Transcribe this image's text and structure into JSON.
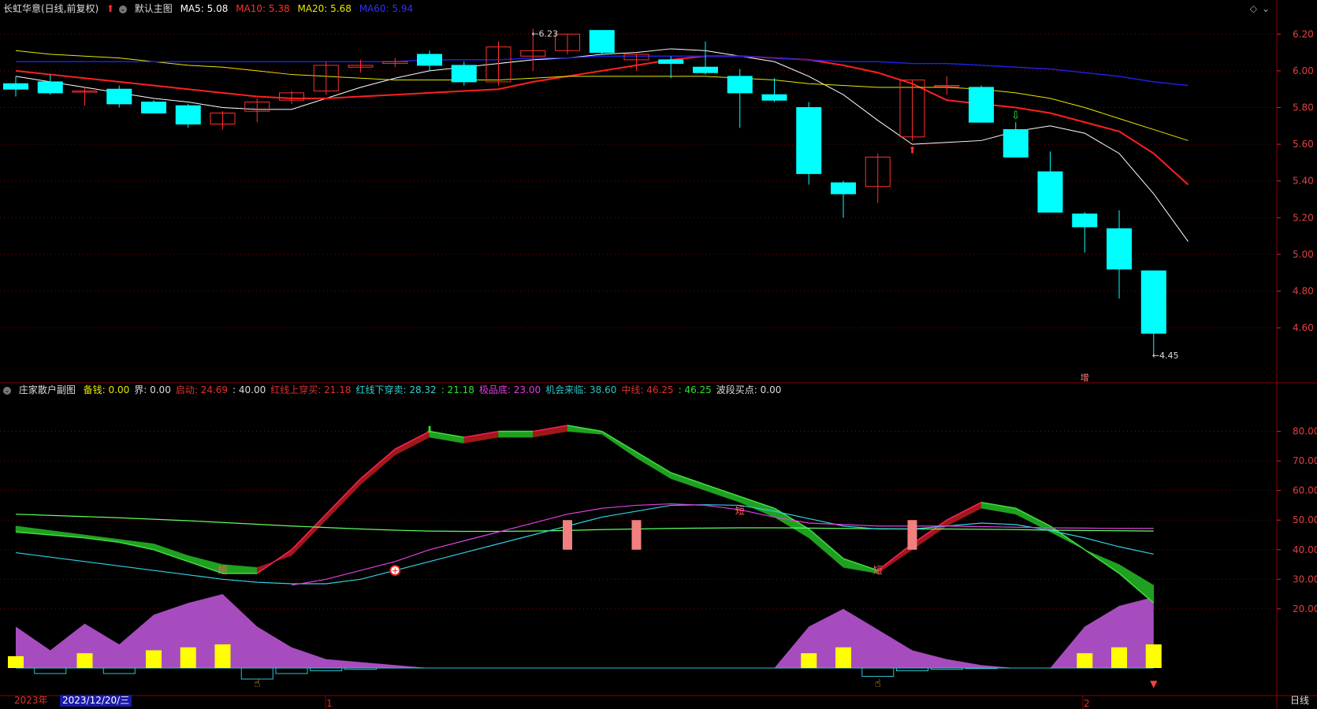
{
  "header": {
    "stock_name": "长虹华意(日线,前复权)",
    "main_chart_name": "默认主图",
    "ma5_label": "MA5: 5.08",
    "ma10_label": "MA10: 5.38",
    "ma20_label": "MA20: 5.68",
    "ma60_label": "MA60: 5.94"
  },
  "sub_header": {
    "indicator_name": "庄家散户副图",
    "items": [
      {
        "text": "备钱: 0.00",
        "color": "#e8e800"
      },
      {
        "text": "界: 0.00",
        "color": "#dddddd"
      },
      {
        "text": "启动: 24.69",
        "color": "#e03030"
      },
      {
        "text": ": 40.00",
        "color": "#dddddd"
      },
      {
        "text": "红线上穿买: 21.18",
        "color": "#e03030"
      },
      {
        "text": "红线下穿卖: 28.32",
        "color": "#30d0d0"
      },
      {
        "text": ": 21.18",
        "color": "#30e030"
      },
      {
        "text": "极品底: 23.00",
        "color": "#e040e0"
      },
      {
        "text": "机会来临: 38.60",
        "color": "#30c0c0"
      },
      {
        "text": "中线: 46.25",
        "color": "#e03030"
      },
      {
        "text": ": 46.25",
        "color": "#30e030"
      },
      {
        "text": "波段买点: 0.00",
        "color": "#dddddd"
      }
    ]
  },
  "footer": {
    "year": "2023年",
    "cursor_date": "2023/12/20/三",
    "month_marks": [
      "1",
      "2"
    ],
    "period": "日线"
  },
  "colors": {
    "up": "#ff3030",
    "down": "#00ffff",
    "ma5": "#ffffff",
    "ma10": "#ff2020",
    "ma20": "#e8e800",
    "ma60": "#2020e0",
    "grid": "#8b0000"
  },
  "chart_data": [
    {
      "type": "candlestick",
      "title": "长虹华意(日线,前复权)",
      "ylim": [
        4.3,
        6.3
      ],
      "y_ticks": [
        "6.20",
        "6.00",
        "5.80",
        "5.60",
        "5.40",
        "5.20",
        "5.00",
        "4.80",
        "4.60"
      ],
      "max_label": "6.23",
      "min_label": "4.45",
      "annotation": "增",
      "candles": [
        {
          "o": 5.93,
          "h": 5.97,
          "l": 5.86,
          "c": 5.9
        },
        {
          "o": 5.94,
          "h": 5.98,
          "l": 5.87,
          "c": 5.88
        },
        {
          "o": 5.89,
          "h": 5.91,
          "l": 5.81,
          "c": 5.89
        },
        {
          "o": 5.9,
          "h": 5.92,
          "l": 5.8,
          "c": 5.82
        },
        {
          "o": 5.83,
          "h": 5.84,
          "l": 5.77,
          "c": 5.77
        },
        {
          "o": 5.81,
          "h": 5.82,
          "l": 5.69,
          "c": 5.71
        },
        {
          "o": 5.71,
          "h": 5.78,
          "l": 5.68,
          "c": 5.77
        },
        {
          "o": 5.78,
          "h": 5.85,
          "l": 5.72,
          "c": 5.83
        },
        {
          "o": 5.84,
          "h": 5.89,
          "l": 5.82,
          "c": 5.88
        },
        {
          "o": 5.89,
          "h": 6.05,
          "l": 5.87,
          "c": 6.03
        },
        {
          "o": 6.02,
          "h": 6.06,
          "l": 5.99,
          "c": 6.03
        },
        {
          "o": 6.04,
          "h": 6.07,
          "l": 6.02,
          "c": 6.05
        },
        {
          "o": 6.09,
          "h": 6.11,
          "l": 6.0,
          "c": 6.03
        },
        {
          "o": 6.03,
          "h": 6.05,
          "l": 5.92,
          "c": 5.94
        },
        {
          "o": 5.94,
          "h": 6.16,
          "l": 5.92,
          "c": 6.13
        },
        {
          "o": 6.08,
          "h": 6.23,
          "l": 6.0,
          "c": 6.11
        },
        {
          "o": 6.11,
          "h": 6.2,
          "l": 6.09,
          "c": 6.2
        },
        {
          "o": 6.22,
          "h": 6.22,
          "l": 6.09,
          "c": 6.1
        },
        {
          "o": 6.06,
          "h": 6.09,
          "l": 6.0,
          "c": 6.09
        },
        {
          "o": 6.06,
          "h": 6.08,
          "l": 5.96,
          "c": 6.04
        },
        {
          "o": 6.02,
          "h": 6.16,
          "l": 5.98,
          "c": 5.99
        },
        {
          "o": 5.97,
          "h": 6.01,
          "l": 5.69,
          "c": 5.88
        },
        {
          "o": 5.87,
          "h": 5.96,
          "l": 5.83,
          "c": 5.84
        },
        {
          "o": 5.8,
          "h": 5.83,
          "l": 5.38,
          "c": 5.44
        },
        {
          "o": 5.39,
          "h": 5.4,
          "l": 5.2,
          "c": 5.33
        },
        {
          "o": 5.37,
          "h": 5.55,
          "l": 5.28,
          "c": 5.53
        },
        {
          "o": 5.64,
          "h": 5.95,
          "l": 5.62,
          "c": 5.95
        },
        {
          "o": 5.92,
          "h": 5.97,
          "l": 5.87,
          "c": 5.92
        },
        {
          "o": 5.91,
          "h": 5.92,
          "l": 5.72,
          "c": 5.72
        },
        {
          "o": 5.68,
          "h": 5.72,
          "l": 5.53,
          "c": 5.53
        },
        {
          "o": 5.45,
          "h": 5.56,
          "l": 5.23,
          "c": 5.23
        },
        {
          "o": 5.22,
          "h": 5.23,
          "l": 5.01,
          "c": 5.15
        },
        {
          "o": 5.14,
          "h": 5.24,
          "l": 4.76,
          "c": 4.92
        },
        {
          "o": 4.91,
          "h": 4.91,
          "l": 4.45,
          "c": 4.57
        }
      ],
      "series": [
        {
          "name": "MA5",
          "values": [
            5.97,
            5.94,
            5.91,
            5.88,
            5.85,
            5.83,
            5.8,
            5.79,
            5.79,
            5.85,
            5.91,
            5.96,
            6.0,
            6.02,
            6.04,
            6.06,
            6.07,
            6.09,
            6.1,
            6.12,
            6.11,
            6.08,
            6.05,
            5.97,
            5.87,
            5.73,
            5.6,
            5.61,
            5.62,
            5.67,
            5.7,
            5.66,
            5.55,
            5.33,
            5.07
          ]
        },
        {
          "name": "MA10",
          "values": [
            6.0,
            5.98,
            5.96,
            5.94,
            5.92,
            5.9,
            5.88,
            5.86,
            5.85,
            5.85,
            5.86,
            5.87,
            5.88,
            5.89,
            5.9,
            5.94,
            5.97,
            6.0,
            6.03,
            6.06,
            6.08,
            6.08,
            6.07,
            6.06,
            6.03,
            5.99,
            5.93,
            5.84,
            5.82,
            5.8,
            5.77,
            5.72,
            5.67,
            5.55,
            5.38
          ]
        },
        {
          "name": "MA20",
          "values": [
            6.11,
            6.09,
            6.08,
            6.07,
            6.05,
            6.03,
            6.02,
            6.0,
            5.98,
            5.97,
            5.96,
            5.95,
            5.95,
            5.95,
            5.95,
            5.96,
            5.97,
            5.97,
            5.97,
            5.97,
            5.97,
            5.96,
            5.95,
            5.93,
            5.92,
            5.91,
            5.91,
            5.91,
            5.9,
            5.88,
            5.85,
            5.8,
            5.74,
            5.68,
            5.62
          ]
        },
        {
          "name": "MA60",
          "values": [
            6.05,
            6.05,
            6.05,
            6.05,
            6.05,
            6.05,
            6.05,
            6.05,
            6.05,
            6.05,
            6.05,
            6.05,
            6.06,
            6.06,
            6.06,
            6.07,
            6.07,
            6.08,
            6.08,
            6.08,
            6.08,
            6.08,
            6.07,
            6.06,
            6.05,
            6.05,
            6.04,
            6.04,
            6.03,
            6.02,
            6.01,
            5.99,
            5.97,
            5.94,
            5.92
          ]
        }
      ]
    },
    {
      "type": "indicator",
      "title": "庄家散户副图",
      "ylim": [
        0,
        90
      ],
      "y_ticks": [
        "80.00",
        "70.00",
        "60.00",
        "50.00",
        "40.00",
        "30.00",
        "20.00"
      ],
      "band_upper": [
        48,
        46.5,
        45,
        43.5,
        42,
        38,
        35,
        34,
        38,
        50,
        62,
        72,
        78,
        76,
        78,
        78,
        80,
        79,
        71,
        64,
        60,
        56,
        51,
        44,
        34,
        32,
        40,
        48,
        54,
        52,
        46,
        40,
        35,
        28
      ],
      "band_lower": [
        46,
        45,
        44,
        42.5,
        40,
        36,
        32,
        32,
        40,
        52,
        64,
        74,
        80,
        78,
        80,
        80,
        82,
        80,
        73,
        66,
        62,
        58,
        54,
        47,
        37,
        33,
        42,
        50,
        56,
        54,
        48,
        40,
        32,
        22
      ],
      "green_line": [
        52,
        51.6,
        51.2,
        50.8,
        50.3,
        49.8,
        49.2,
        48.6,
        48,
        47.5,
        47,
        46.6,
        46.3,
        46.2,
        46.2,
        46.3,
        46.5,
        46.8,
        47,
        47.2,
        47.3,
        47.4,
        47.4,
        47.3,
        47.2,
        47.1,
        47,
        47,
        46.9,
        46.8,
        46.6,
        46.5,
        46.4,
        46.3
      ],
      "cyan_line": [
        39,
        37.5,
        36,
        34.5,
        33,
        31.5,
        30,
        29,
        28.5,
        28.5,
        30,
        33,
        36,
        39,
        42,
        45,
        48,
        51,
        53,
        55,
        55.2,
        55,
        53,
        50.5,
        48,
        47,
        47,
        48,
        49,
        48.5,
        46.5,
        44,
        41,
        38.5
      ],
      "magenta_line": [
        null,
        null,
        null,
        null,
        null,
        null,
        null,
        null,
        28,
        30,
        33,
        36,
        40,
        43,
        46,
        49,
        52,
        54,
        55,
        55.5,
        55,
        53.5,
        51,
        49,
        48.5,
        48,
        48,
        48,
        47.8,
        47.6,
        47.4,
        47.3,
        47.2,
        47.2
      ],
      "pink_bars": [
        null,
        null,
        null,
        null,
        null,
        null,
        null,
        null,
        null,
        null,
        null,
        null,
        null,
        null,
        null,
        null,
        46,
        null,
        46,
        null,
        null,
        null,
        null,
        null,
        null,
        null,
        46,
        null,
        null,
        null,
        null,
        null,
        null,
        null
      ],
      "purple_area": [
        14,
        6,
        15,
        8,
        18,
        22,
        25,
        14,
        7,
        3,
        2,
        1,
        0,
        0,
        0,
        0,
        0,
        0,
        0,
        0,
        0,
        0,
        0,
        14,
        20,
        13,
        6,
        3,
        1,
        0,
        0,
        14,
        21,
        24
      ],
      "yellow_bars": [
        4,
        null,
        5,
        null,
        6,
        7,
        8,
        null,
        null,
        null,
        null,
        null,
        null,
        null,
        null,
        null,
        null,
        null,
        null,
        null,
        null,
        null,
        null,
        5,
        7,
        null,
        null,
        null,
        null,
        null,
        null,
        5,
        7,
        8
      ],
      "cyan_bars": [
        null,
        -2,
        null,
        -2,
        null,
        null,
        null,
        -4,
        -2,
        -1,
        -0.5,
        null,
        null,
        null,
        null,
        null,
        null,
        null,
        null,
        null,
        null,
        null,
        null,
        null,
        null,
        -3,
        -1,
        -0.5,
        -0.2,
        null,
        null,
        null,
        null,
        null
      ],
      "labels": [
        "短",
        "短",
        "短"
      ]
    }
  ]
}
